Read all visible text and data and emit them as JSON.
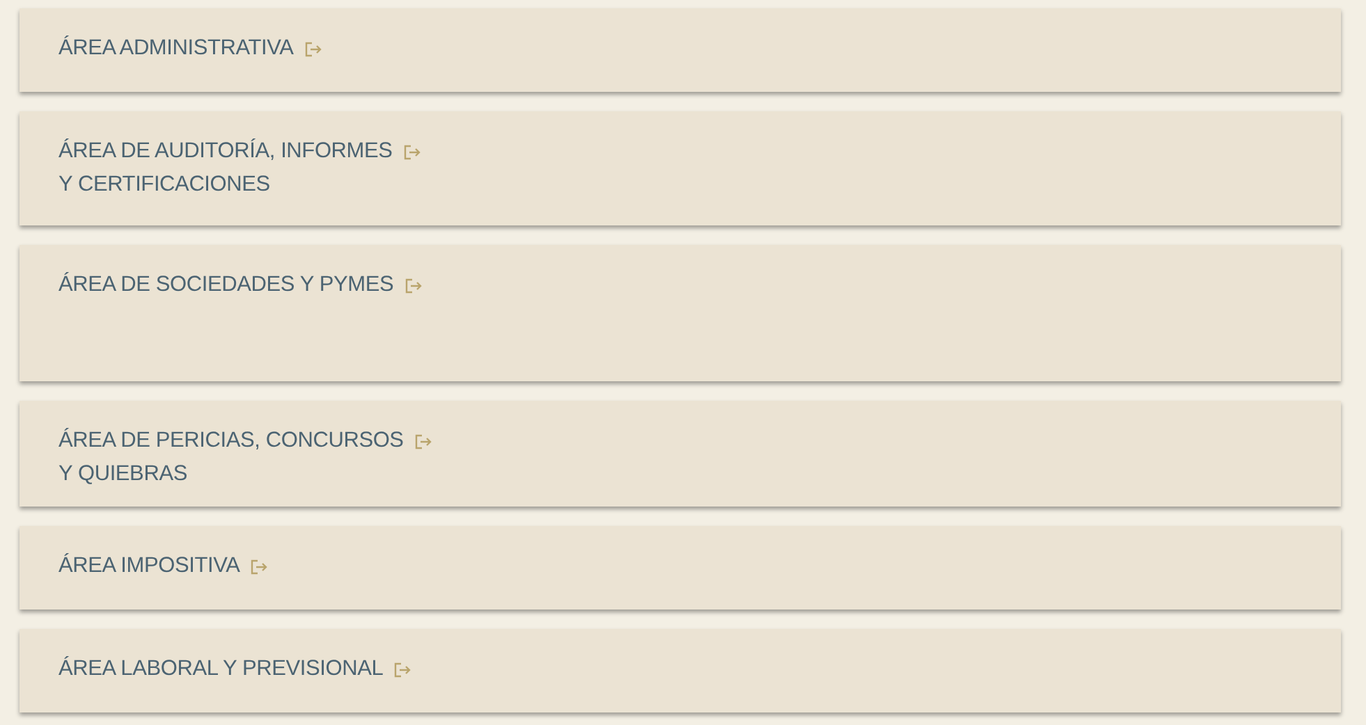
{
  "areas": [
    {
      "lines": [
        "ÁREA ADMINISTRATIVA"
      ]
    },
    {
      "lines": [
        "ÁREA DE AUDITORÍA, INFORMES",
        "Y CERTIFICACIONES"
      ]
    },
    {
      "lines": [
        "ÁREA DE SOCIEDADES Y PYMES"
      ]
    },
    {
      "lines": [
        "ÁREA DE PERICIAS, CONCURSOS",
        "Y QUIEBRAS"
      ]
    },
    {
      "lines": [
        "ÁREA IMPOSITIVA"
      ]
    },
    {
      "lines": [
        "ÁREA LABORAL Y PREVISIONAL"
      ]
    }
  ]
}
